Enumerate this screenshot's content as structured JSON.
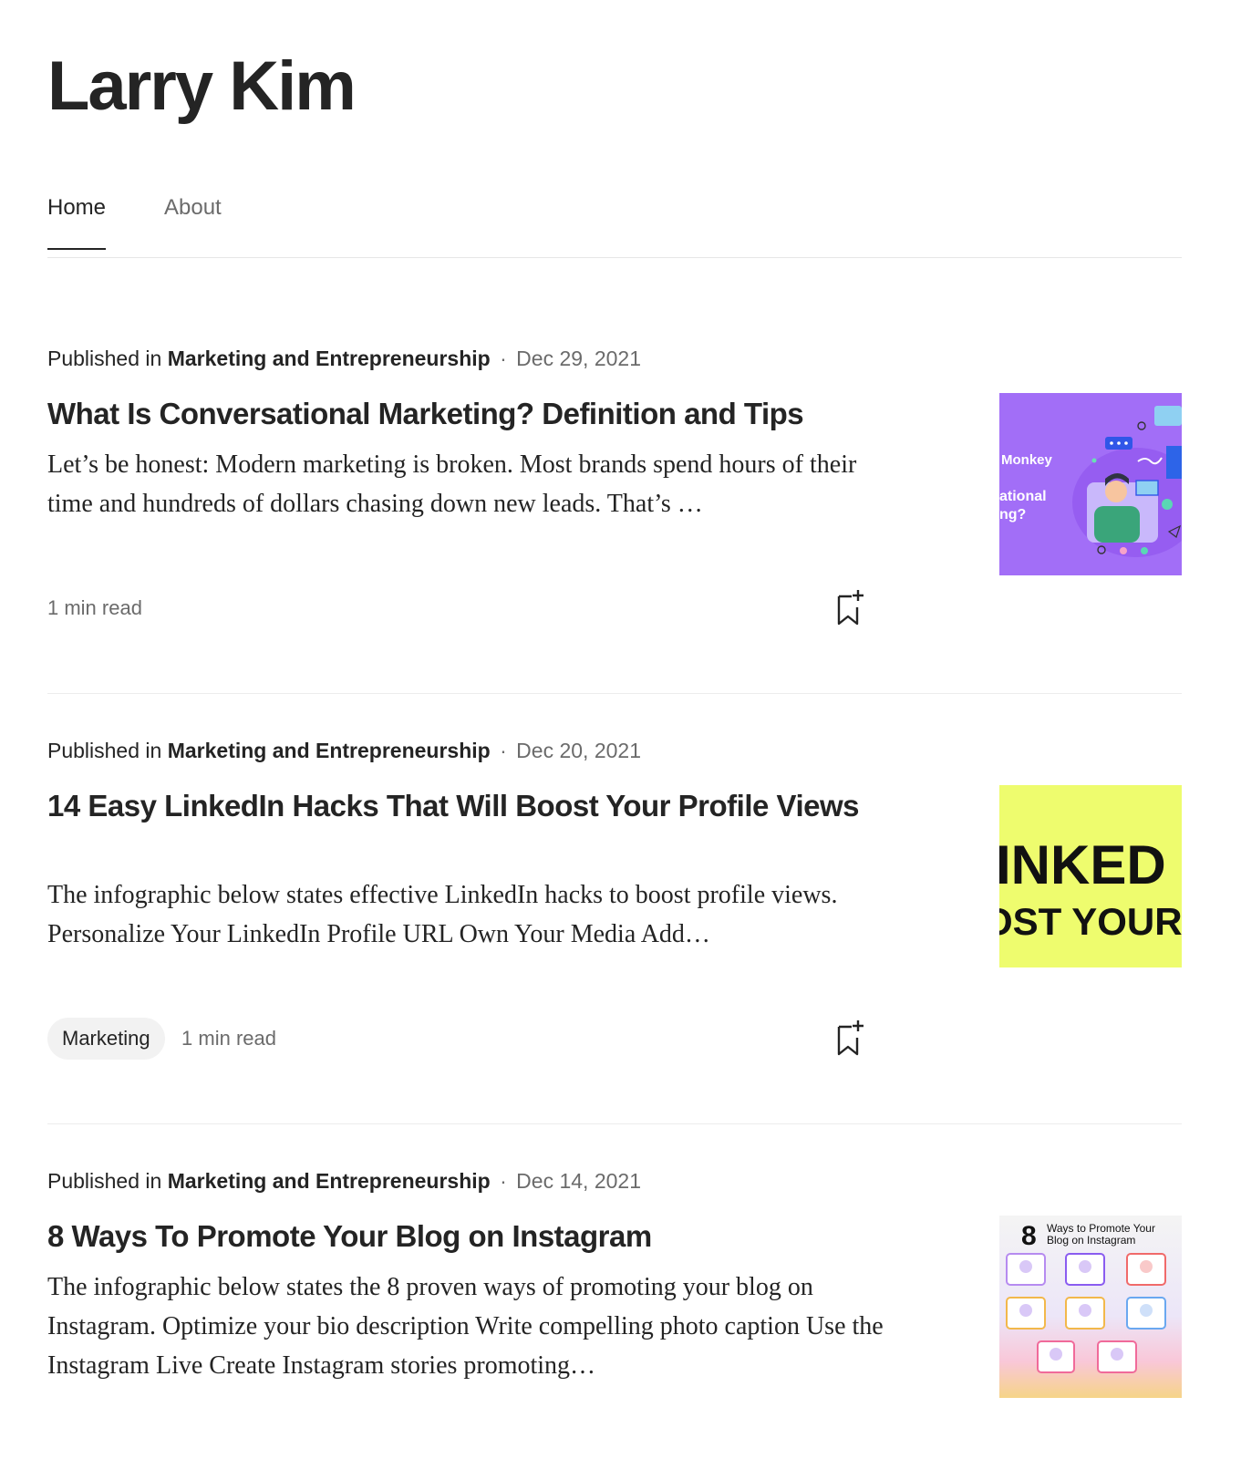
{
  "profile": {
    "name": "Larry Kim"
  },
  "tabs": [
    {
      "label": "Home",
      "active": true
    },
    {
      "label": "About",
      "active": false
    }
  ],
  "articles": [
    {
      "published_prefix": "Published in",
      "publication": "Marketing and Entrepreneurship",
      "separator": "·",
      "date": "Dec 29, 2021",
      "title": "What Is Conversational Marketing? Definition and Tips",
      "excerpt": "Let’s be honest: Modern marketing is broken. Most brands spend hours of their time and hundreds of dollars chasing down new leads. That’s …",
      "tag": "",
      "read_time": "1 min read",
      "thumbnail": {
        "text_line1": "Monkey",
        "text_line2": "ational",
        "text_line3": "ng?",
        "bg": "#a16df7"
      }
    },
    {
      "published_prefix": "Published in",
      "publication": "Marketing and Entrepreneurship",
      "separator": "·",
      "date": "Dec 20, 2021",
      "title": "14 Easy LinkedIn Hacks That Will Boost Your Profile Views",
      "excerpt": "The infographic below states effective LinkedIn hacks to boost profile views. Personalize Your LinkedIn Profile URL Own Your Media Add…",
      "tag": "Marketing",
      "read_time": "1 min read",
      "thumbnail": {
        "text_line1": "INKED",
        "text_line2": "OST YOUR",
        "bg": "#eefc6e"
      }
    },
    {
      "published_prefix": "Published in",
      "publication": "Marketing and Entrepreneurship",
      "separator": "·",
      "date": "Dec 14, 2021",
      "title": "8 Ways To Promote Your Blog on Instagram",
      "excerpt": "The infographic below states the 8 proven ways of promoting your blog on Instagram. Optimize your bio description Write compelling photo caption Use the Instagram Live Create Instagram stories promoting…",
      "tag": "",
      "read_time": "",
      "thumbnail": {
        "big_number": "8",
        "heading_line1": "Ways to Promote Your",
        "heading_line2": "Blog on Instagram"
      }
    }
  ],
  "colors": {
    "text_primary": "#242424",
    "text_secondary": "#6b6b6b",
    "divider": "#e6e6e6",
    "pill_bg": "#f2f2f2"
  },
  "icons": {
    "bookmark": "bookmark-plus-icon"
  }
}
